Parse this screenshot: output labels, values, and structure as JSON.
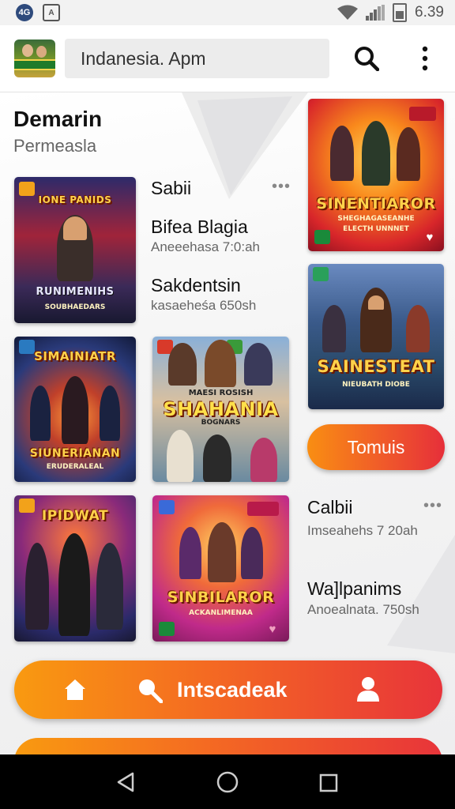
{
  "status_bar": {
    "left_badge": "4G",
    "time": "6.39"
  },
  "app_bar": {
    "search_value": "Indanesia. Apm"
  },
  "content": {
    "heading": "Demarin",
    "subheading": "Permeasla",
    "list": [
      {
        "title": "Sabii",
        "meta": ""
      },
      {
        "title": "Bifea Blagia",
        "meta": "Aneeehasa  7:0:ah"
      },
      {
        "title": "Sakdentsin",
        "meta": "kasaeheśa  650sh"
      },
      {
        "title": "Calbii",
        "meta": "Imseahehs 7  20ah"
      },
      {
        "title": "Wa]lpanims",
        "meta": "Anoealnata. 750sh"
      }
    ],
    "more_glyph": "•••",
    "cards": [
      {
        "title": "IONE PANIDS",
        "subtitle": "RUNIMENIHS",
        "caption": "SOUBHAEDARS"
      },
      {
        "title": "SINENTIAROR",
        "subtitle": "SHEGHAGASEANHE",
        "caption": "ELECTH UNNNET"
      },
      {
        "title": "SIMAINIATR",
        "subtitle": "SIUNERIANAN",
        "caption": "ERUDERALEAL"
      },
      {
        "title": "SHAHANIA",
        "subtitle": "MAESI ROSISH",
        "caption": "BOGNARS"
      },
      {
        "title": "SAINESTEAT",
        "subtitle": "NIEUBATH DIOBE",
        "caption": ""
      },
      {
        "title": "IPIDWAT",
        "subtitle": "",
        "caption": ""
      },
      {
        "title": "SINBILAROR",
        "subtitle": "ACKANLIMENAA",
        "caption": ""
      }
    ],
    "pill_button": "Tomuis"
  },
  "bottom_nav": {
    "label": "Intscadeak"
  },
  "colors": {
    "accent_orange": "#f99a10",
    "accent_red": "#e8343a",
    "status_bg": "#f2f2f2"
  },
  "icons": [
    "network-badge",
    "app-square-icon",
    "wifi-icon",
    "signal-icon",
    "battery-icon",
    "search-icon",
    "overflow-menu-icon",
    "home-icon",
    "user-icon",
    "back-icon",
    "circle-home-icon",
    "recents-icon",
    "heart-icon"
  ]
}
